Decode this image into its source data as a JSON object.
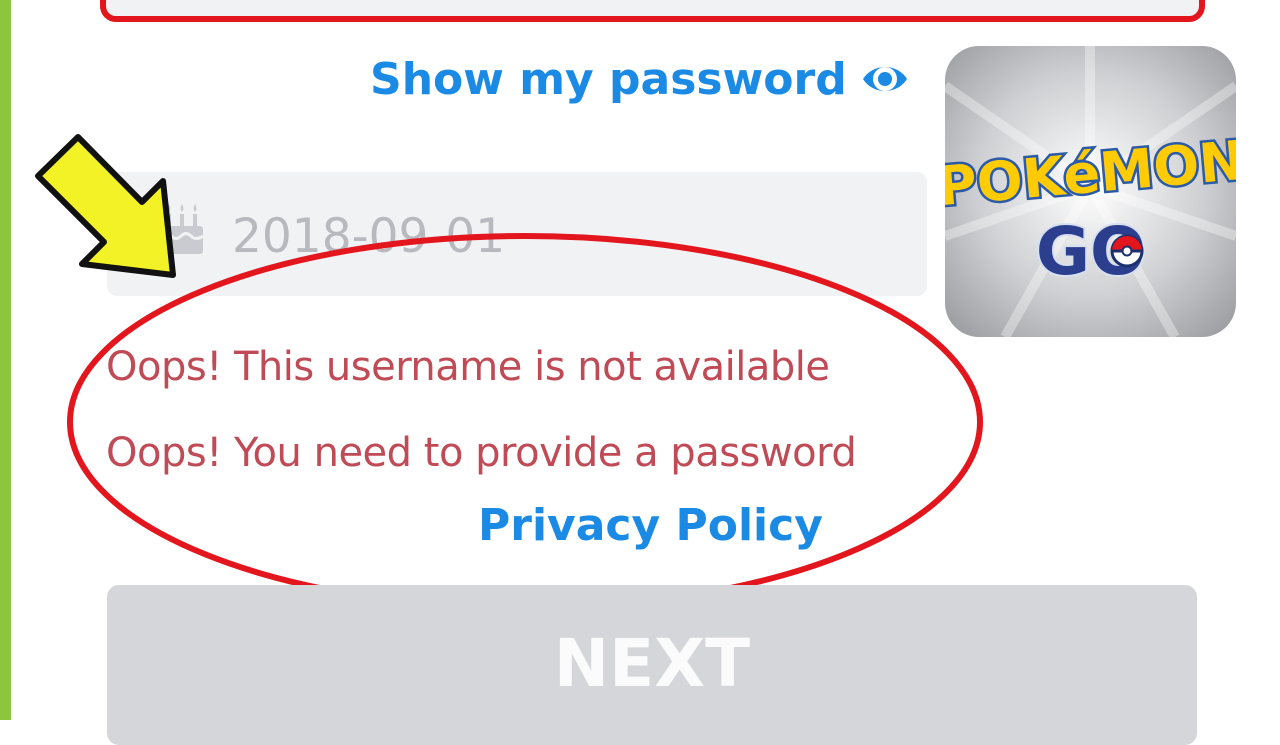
{
  "show_password": {
    "label": "Show my password",
    "icon": "eye-icon"
  },
  "birthdate": {
    "value": "2018-09-01",
    "icon": "cake-icon"
  },
  "errors": {
    "username": "Oops! This username is not available",
    "password": "Oops! You need to provide a password"
  },
  "privacy_link": "Privacy Policy",
  "next_button": "NEXT",
  "logo": {
    "line1": "POKéMON",
    "line2": "GO",
    "icon": "pokemon-go-logo"
  },
  "colors": {
    "link": "#1a8ae5",
    "error": "#c04a55",
    "annotation_red": "#e3161e",
    "arrow_yellow": "#f2f227",
    "button_disabled": "#d4d6da",
    "side_bar": "#8cc63f"
  }
}
